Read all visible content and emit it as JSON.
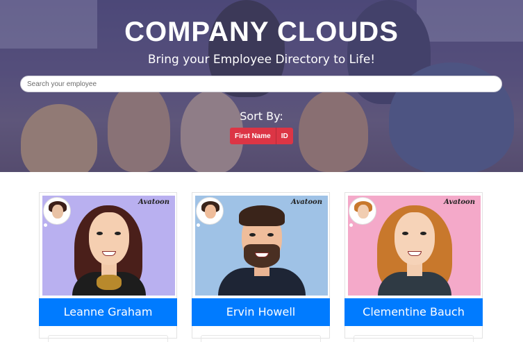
{
  "header": {
    "title": "COMPANY CLOUDS",
    "subtitle": "Bring your Employee Directory to Life!"
  },
  "search": {
    "placeholder": "Search your employee",
    "value": ""
  },
  "sort": {
    "label": "Sort By:",
    "buttons": [
      "First Name",
      "ID"
    ]
  },
  "employees": [
    {
      "name": "Leanne Graham",
      "brand": "Avatoon",
      "background": "#b9b0f0",
      "icon": "avatar-icon"
    },
    {
      "name": "Ervin Howell",
      "brand": "Avatoon",
      "background": "#9fc2e6",
      "icon": "avatar-icon"
    },
    {
      "name": "Clementine Bauch",
      "brand": "Avatoon",
      "background": "#f4a9c9",
      "icon": "avatar-icon"
    }
  ],
  "colors": {
    "accent": "#007bff",
    "sort_button": "#dc3545"
  }
}
